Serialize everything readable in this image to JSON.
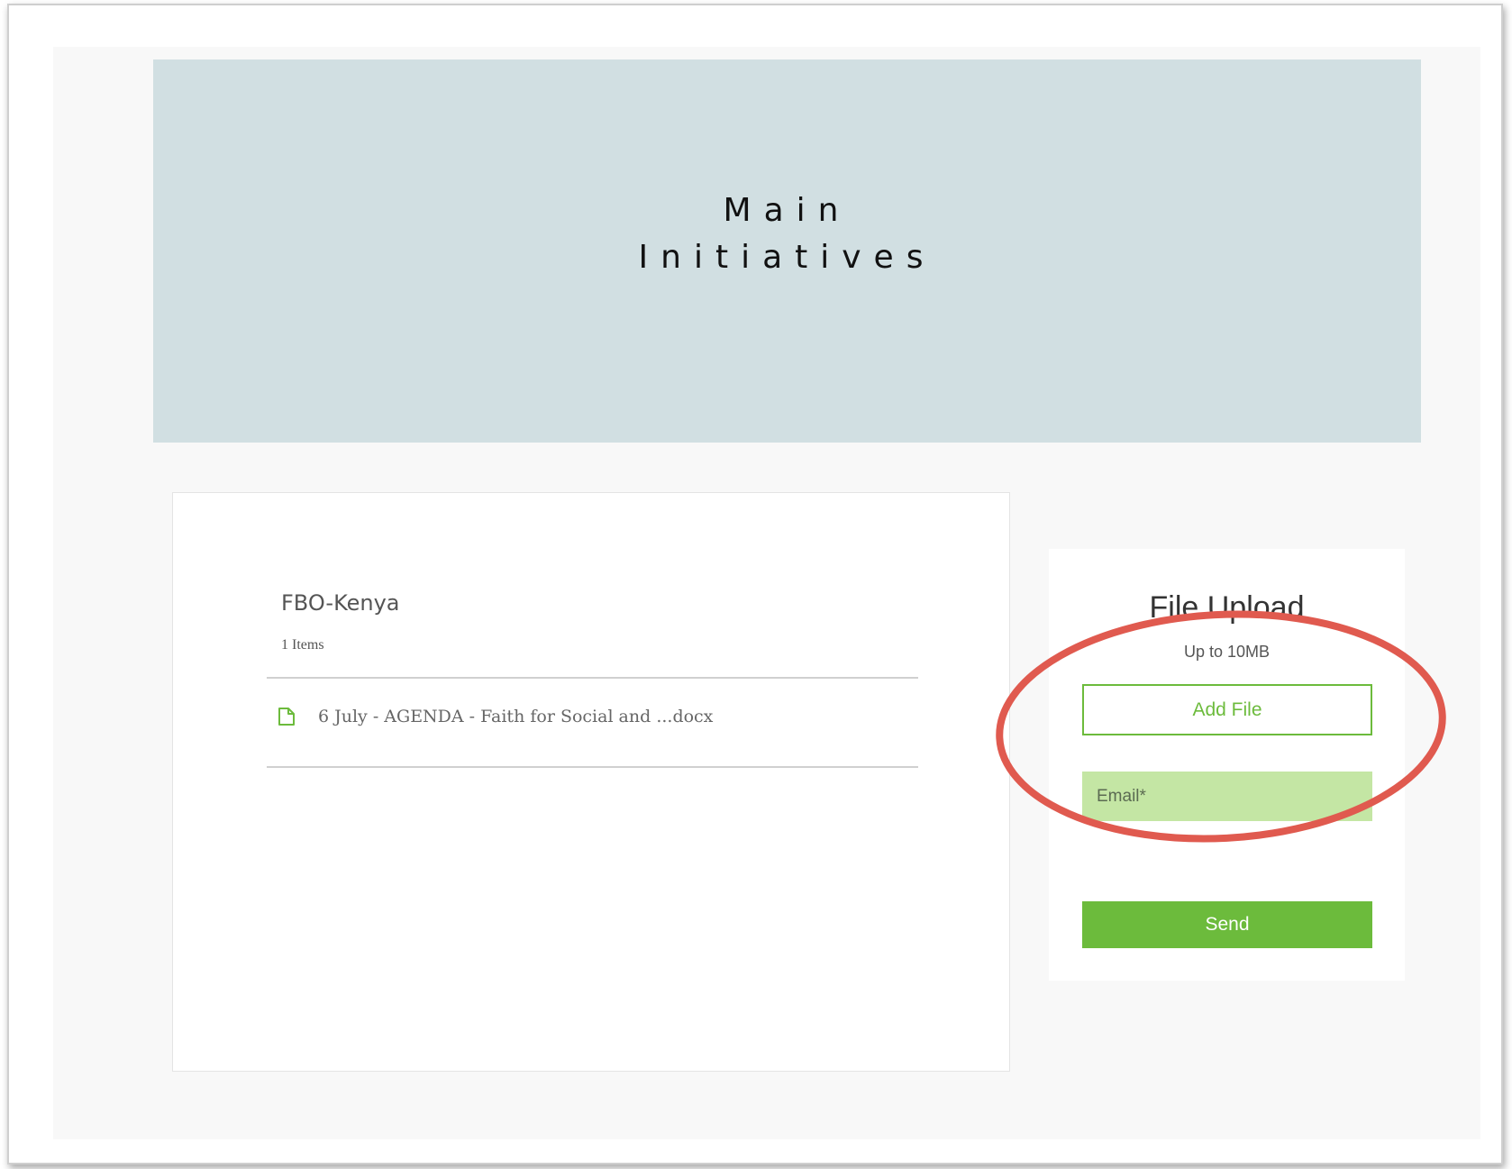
{
  "banner": {
    "title_line1": "Main",
    "title_line2": "Initiatives",
    "background": "#d1dfe2"
  },
  "documents": {
    "folder_name": "FBO-Kenya",
    "item_count": "1 Items",
    "files": [
      {
        "name": "6 July - AGENDA - Faith for Social and ...docx",
        "icon": "document-icon"
      }
    ]
  },
  "upload": {
    "title": "File Upload",
    "subtitle": "Up to 10MB",
    "add_file_label": "Add File",
    "email_placeholder": "Email*",
    "email_value": "",
    "send_label": "Send",
    "accent_color": "#6cbb3c",
    "field_color": "#c4e6a4"
  },
  "annotation": {
    "shape": "ellipse",
    "color": "#e05a4f"
  }
}
